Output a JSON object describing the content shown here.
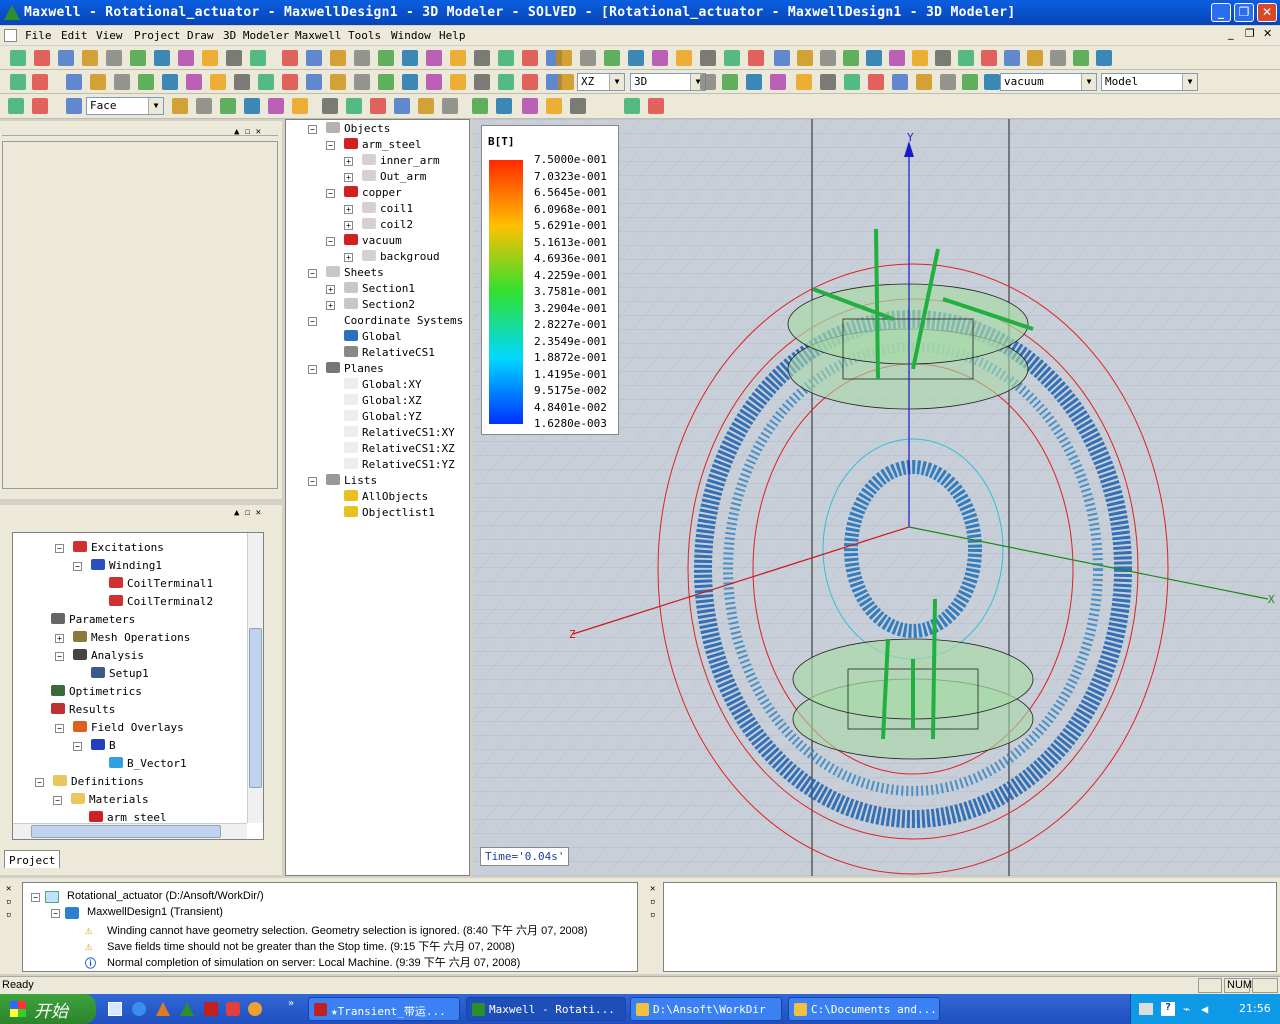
{
  "window": {
    "title": "Maxwell - Rotational_actuator - MaxwellDesign1 - 3D Modeler - SOLVED - [Rotational_actuator - MaxwellDesign1 - 3D Modeler]"
  },
  "menu": [
    "File",
    "Edit",
    "View",
    "Project",
    "Draw",
    "3D Modeler",
    "Maxwell",
    "Tools",
    "Window",
    "Help"
  ],
  "toolbar": {
    "plane_select": "XZ",
    "view_select": "3D",
    "material_select": "vacuum",
    "model_select": "Model",
    "select_mode": "Face"
  },
  "model_tree": {
    "objects": "Objects",
    "arm_steel": "arm_steel",
    "inner_arm": "inner_arm",
    "out_arm": "Out_arm",
    "copper": "copper",
    "coil1": "coil1",
    "coil2": "coil2",
    "vacuum": "vacuum",
    "backgroud": "backgroud",
    "sheets": "Sheets",
    "section1": "Section1",
    "section2": "Section2",
    "coordinate_systems": "Coordinate Systems",
    "global": "Global",
    "relativecs1": "RelativeCS1",
    "planes": "Planes",
    "plane_items": [
      "Global:XY",
      "Global:XZ",
      "Global:YZ",
      "RelativeCS1:XY",
      "RelativeCS1:XZ",
      "RelativeCS1:YZ"
    ],
    "lists": "Lists",
    "allobjects": "AllObjects",
    "objectlist1": "Objectlist1"
  },
  "project_tree": {
    "excitations": "Excitations",
    "winding1": "Winding1",
    "coilterminal1": "CoilTerminal1",
    "coilterminal2": "CoilTerminal2",
    "parameters": "Parameters",
    "mesh_operations": "Mesh Operations",
    "analysis": "Analysis",
    "setup1": "Setup1",
    "optimetrics": "Optimetrics",
    "results": "Results",
    "field_overlays": "Field Overlays",
    "b": "B",
    "b_vector1": "B_Vector1",
    "definitions": "Definitions",
    "materials": "Materials",
    "arm_steel": "arm_steel",
    "tab": "Project"
  },
  "legend": {
    "title": "B[T]",
    "values": [
      "7.5000e-001",
      "7.0323e-001",
      "6.5645e-001",
      "6.0968e-001",
      "5.6291e-001",
      "5.1613e-001",
      "4.6936e-001",
      "4.2259e-001",
      "3.7581e-001",
      "3.2904e-001",
      "2.8227e-001",
      "2.3549e-001",
      "1.8872e-001",
      "1.4195e-001",
      "9.5175e-002",
      "4.8401e-002",
      "1.6280e-003"
    ]
  },
  "viewport": {
    "time_label": "Time='0.04s'",
    "axis_y": "Y",
    "axis_x": "X",
    "axis_z": "Z"
  },
  "messages": {
    "project": "Rotational_actuator (D:/Ansoft/WorkDir/)",
    "design": "MaxwellDesign1 (Transient)",
    "items": [
      "Winding cannot have geometry selection.  Geometry selection is ignored. (8:40 下午  六月 07, 2008)",
      "Save fields time should not be greater than the Stop time. (9:15 下午  六月 07, 2008)",
      "Normal completion of simulation on server: Local Machine. (9:39 下午  六月 07, 2008)"
    ]
  },
  "status": {
    "ready": "Ready",
    "num": "NUM"
  },
  "taskbar": {
    "start": "开始",
    "tasks": [
      "★Transient_带运...",
      "Maxwell - Rotati...",
      "D:\\Ansoft\\WorkDir",
      "C:\\Documents and..."
    ],
    "clock": "21:56"
  },
  "colors": {
    "titlebar": "#0a5fe0",
    "viewport_bg": "#c8cfd8",
    "x_axis": "#1a8a1a",
    "y_axis": "#1a1acc",
    "z_axis": "#cc1a1a"
  }
}
